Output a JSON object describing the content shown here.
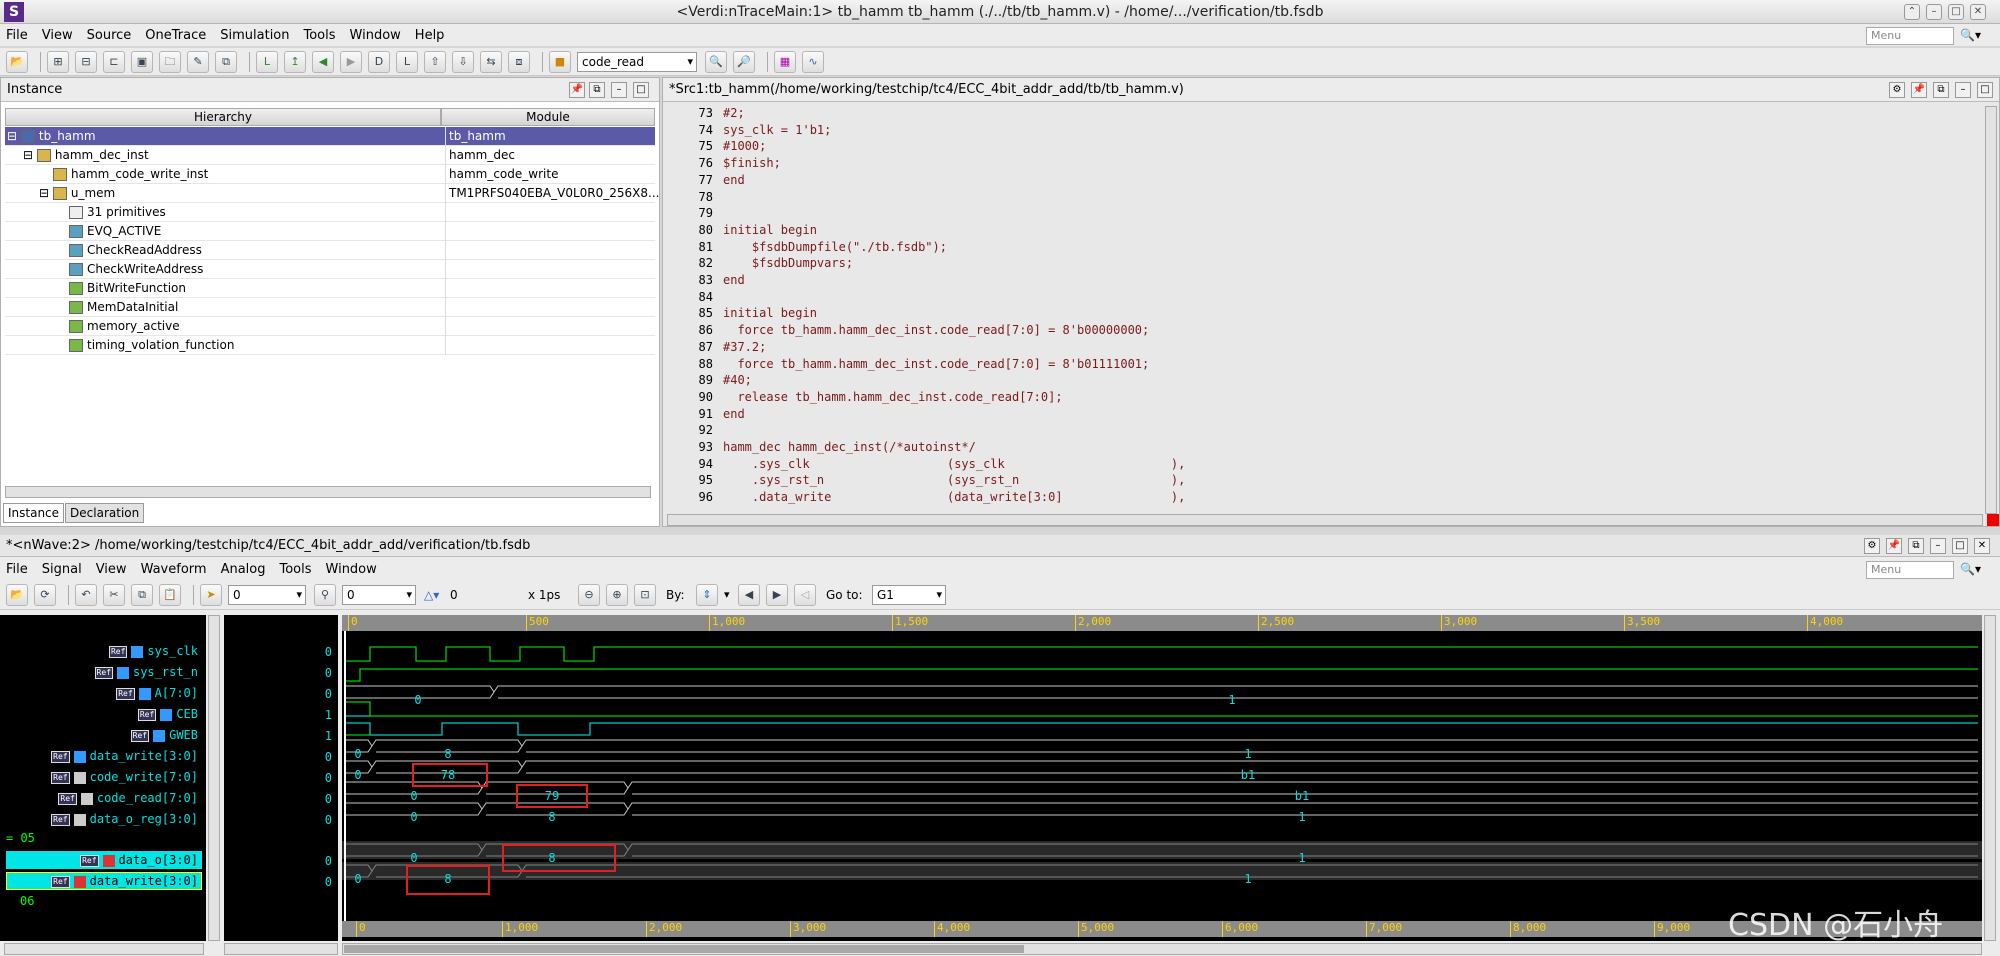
{
  "window": {
    "title": "<Verdi:nTraceMain:1> tb_hamm tb_hamm (./../tb/tb_hamm.v) - /home/.../verification/tb.fsdb",
    "logo": "S"
  },
  "main_menu": [
    "File",
    "View",
    "Source",
    "OneTrace",
    "Simulation",
    "Tools",
    "Window",
    "Help"
  ],
  "menu_search_placeholder": "Menu",
  "toolbar": {
    "signal_combo": "code_read"
  },
  "instance_panel": {
    "title": "Instance",
    "col_hierarchy": "Hierarchy",
    "col_module": "Module",
    "rows": [
      {
        "name": "tb_hamm",
        "module": "tb_hamm"
      },
      {
        "name": "hamm_dec_inst",
        "module": "hamm_dec"
      },
      {
        "name": "hamm_code_write_inst",
        "module": "hamm_code_write"
      },
      {
        "name": "u_mem",
        "module": "TM1PRFS040EBA_V0L0R0_256X8..."
      },
      {
        "name": "31 primitives",
        "module": ""
      },
      {
        "name": "EVQ_ACTIVE",
        "module": ""
      },
      {
        "name": "CheckReadAddress",
        "module": ""
      },
      {
        "name": "CheckWriteAddress",
        "module": ""
      },
      {
        "name": "BitWriteFunction",
        "module": ""
      },
      {
        "name": "MemDataInitial",
        "module": ""
      },
      {
        "name": "memory_active",
        "module": ""
      },
      {
        "name": "timing_volation_function",
        "module": ""
      }
    ],
    "tabs": [
      "Instance",
      "Declaration"
    ]
  },
  "source_panel": {
    "title": "*Src1:tb_hamm(/home/working/testchip/tc4/ECC_4bit_addr_add/tb/tb_hamm.v)",
    "lines": [
      {
        "n": "73",
        "t": "#2;"
      },
      {
        "n": "74",
        "t": "sys_clk = 1'b1;"
      },
      {
        "n": "75",
        "t": "#1000;"
      },
      {
        "n": "76",
        "t": "$finish;"
      },
      {
        "n": "77",
        "t": "end"
      },
      {
        "n": "78",
        "t": ""
      },
      {
        "n": "79",
        "t": ""
      },
      {
        "n": "80",
        "t": "initial begin"
      },
      {
        "n": "81",
        "t": "    $fsdbDumpfile(\"./tb.fsdb\");"
      },
      {
        "n": "82",
        "t": "    $fsdbDumpvars;"
      },
      {
        "n": "83",
        "t": "end"
      },
      {
        "n": "84",
        "t": ""
      },
      {
        "n": "85",
        "t": "initial begin"
      },
      {
        "n": "86",
        "t": "  force tb_hamm.hamm_dec_inst.code_read[7:0] = 8'b00000000;"
      },
      {
        "n": "87",
        "t": "#37.2;"
      },
      {
        "n": "88",
        "t": "  force tb_hamm.hamm_dec_inst.code_read[7:0] = 8'b01111001;"
      },
      {
        "n": "89",
        "t": "#40;"
      },
      {
        "n": "90",
        "t": "  release tb_hamm.hamm_dec_inst.code_read[7:0];"
      },
      {
        "n": "91",
        "t": "end"
      },
      {
        "n": "92",
        "t": ""
      },
      {
        "n": "93",
        "t": "hamm_dec hamm_dec_inst(/*autoinst*/"
      },
      {
        "n": "94",
        "t": "    .sys_clk                   (sys_clk                       ),"
      },
      {
        "n": "95",
        "t": "    .sys_rst_n                 (sys_rst_n                     ),"
      },
      {
        "n": "96",
        "t": "    .data_write                (data_write[3:0]               ),"
      }
    ]
  },
  "wave_window": {
    "title": "*<nWave:2> /home/working/testchip/tc4/ECC_4bit_addr_add/verification/tb.fsdb",
    "menu": [
      "File",
      "Signal",
      "View",
      "Waveform",
      "Analog",
      "Tools",
      "Window"
    ],
    "cursor_time": "0",
    "marker_time": "0",
    "delta": "0",
    "timescale": "x 1ps",
    "by_label": "By:",
    "goto_label": "Go to:",
    "goto_value": "G1",
    "signals": [
      {
        "name": "sys_clk",
        "value": "0"
      },
      {
        "name": "sys_rst_n",
        "value": "0"
      },
      {
        "name": "A[7:0]",
        "value": "0"
      },
      {
        "name": "CEB",
        "value": "1"
      },
      {
        "name": "GWEB",
        "value": "1"
      },
      {
        "name": "data_write[3:0]",
        "value": "0"
      },
      {
        "name": "code_write[7:0]",
        "value": "0"
      },
      {
        "name": "code_read[7:0]",
        "value": "0"
      },
      {
        "name": "data_o_reg[3:0]",
        "value": "0"
      },
      {
        "name": "group_05",
        "value": "= 05"
      },
      {
        "name": "data_o[3:0]",
        "value": "0"
      },
      {
        "name": "data_write[3:0]",
        "value": "0"
      },
      {
        "name": "group_06",
        "value": "06"
      }
    ],
    "top_ruler": [
      "0",
      "500",
      "1,000",
      "1,500",
      "2,000",
      "2,500",
      "3,000",
      "3,500",
      "4,000"
    ],
    "bottom_ruler": [
      "0",
      "1,000",
      "2,000",
      "3,000",
      "4,000",
      "5,000",
      "6,000",
      "7,000",
      "8,000",
      "9,000"
    ],
    "bus_labels": {
      "A": [
        "0",
        "1"
      ],
      "data_write": [
        "0",
        "8",
        "1"
      ],
      "code_write": [
        "0",
        "78",
        "b1"
      ],
      "code_read": [
        "0",
        "79",
        "b1"
      ],
      "data_o_reg": [
        "0",
        "8",
        "1"
      ],
      "data_o": [
        "0",
        "8",
        "1"
      ],
      "data_write2": [
        "0",
        "8",
        "1"
      ]
    }
  },
  "watermark": "CSDN @石小舟"
}
